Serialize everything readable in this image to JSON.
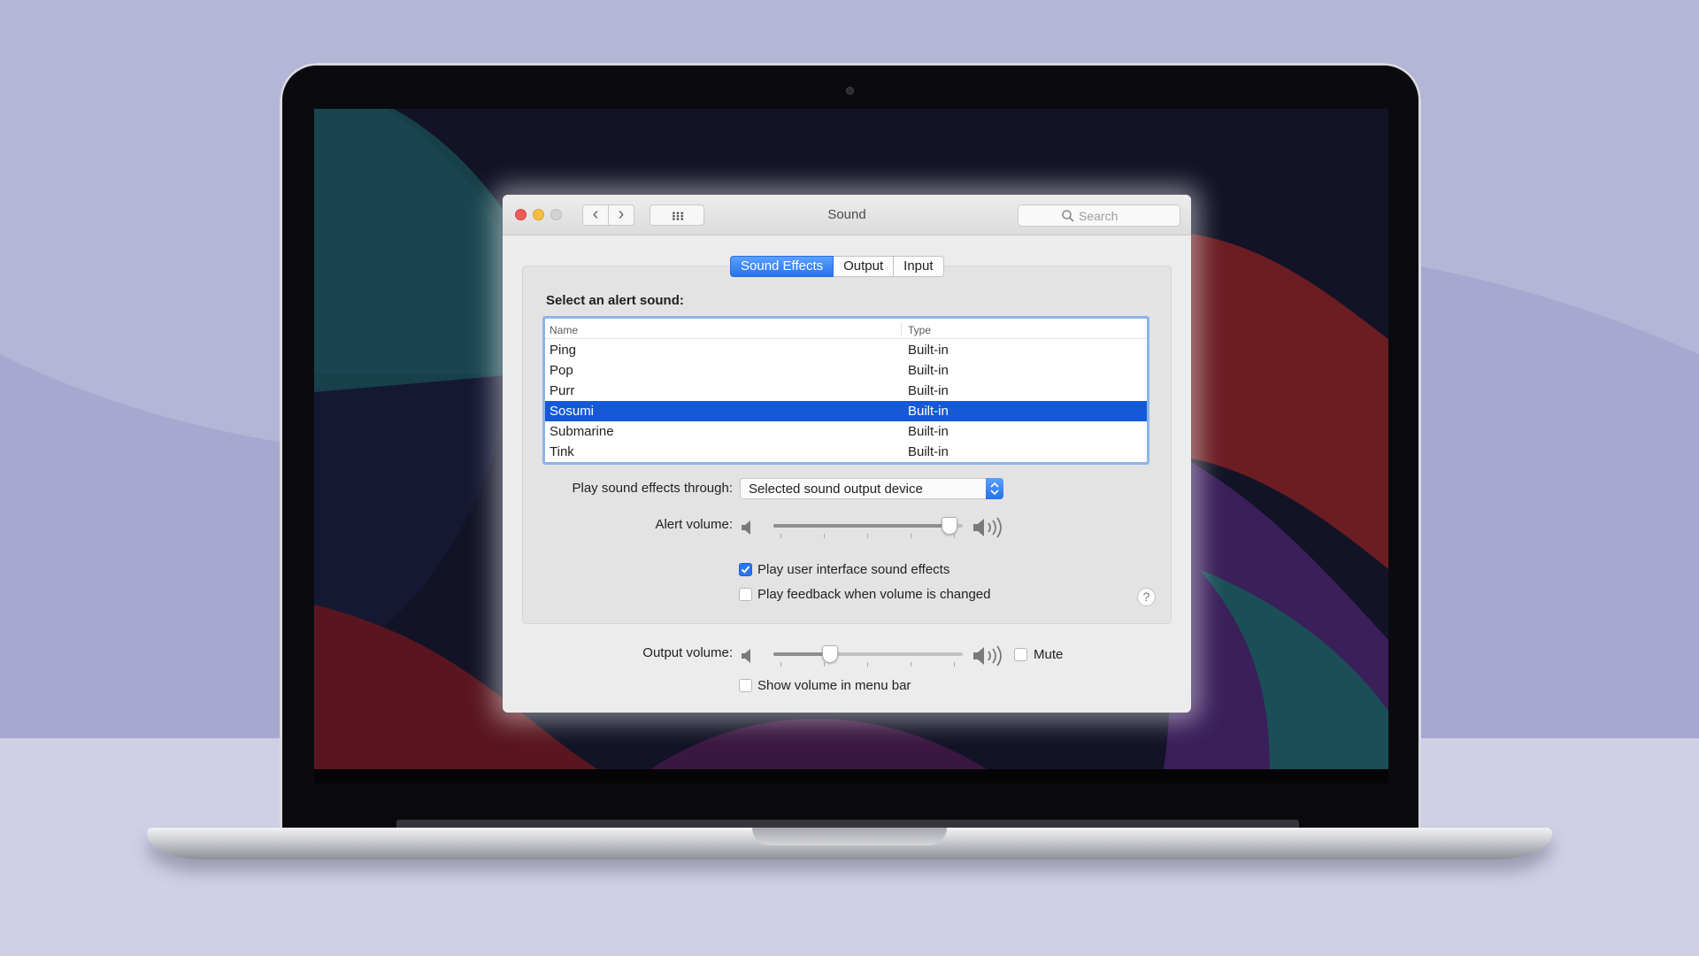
{
  "window": {
    "title": "Sound",
    "search_placeholder": "Search"
  },
  "tabs": [
    {
      "label": "Sound Effects",
      "active": true
    },
    {
      "label": "Output",
      "active": false
    },
    {
      "label": "Input",
      "active": false
    }
  ],
  "alert_sounds": {
    "heading": "Select an alert sound:",
    "columns": {
      "name": "Name",
      "type": "Type"
    },
    "rows": [
      {
        "name": "Ping",
        "type": "Built-in",
        "selected": false
      },
      {
        "name": "Pop",
        "type": "Built-in",
        "selected": false
      },
      {
        "name": "Purr",
        "type": "Built-in",
        "selected": false
      },
      {
        "name": "Sosumi",
        "type": "Built-in",
        "selected": true
      },
      {
        "name": "Submarine",
        "type": "Built-in",
        "selected": false
      },
      {
        "name": "Tink",
        "type": "Built-in",
        "selected": false
      }
    ]
  },
  "play_through": {
    "label": "Play sound effects through:",
    "value": "Selected sound output device"
  },
  "alert_volume": {
    "label": "Alert volume:",
    "level": 0.97
  },
  "options": {
    "ui_sounds": {
      "label": "Play user interface sound effects",
      "checked": true
    },
    "feedback": {
      "label": "Play feedback when volume is changed",
      "checked": false
    }
  },
  "help_label": "?",
  "output_volume": {
    "label": "Output volume:",
    "level": 0.28,
    "mute_label": "Mute",
    "mute_checked": false
  },
  "menu_bar": {
    "label": "Show volume in menu bar",
    "checked": false
  },
  "icons": {
    "speaker_low": "speaker-low-icon",
    "speaker_high": "speaker-high-icon",
    "search": "search-icon",
    "grid": "grid-icon"
  },
  "colors": {
    "accent": "#2672ee",
    "selection": "#1559d9",
    "backdrop": "#b5b7d9"
  }
}
